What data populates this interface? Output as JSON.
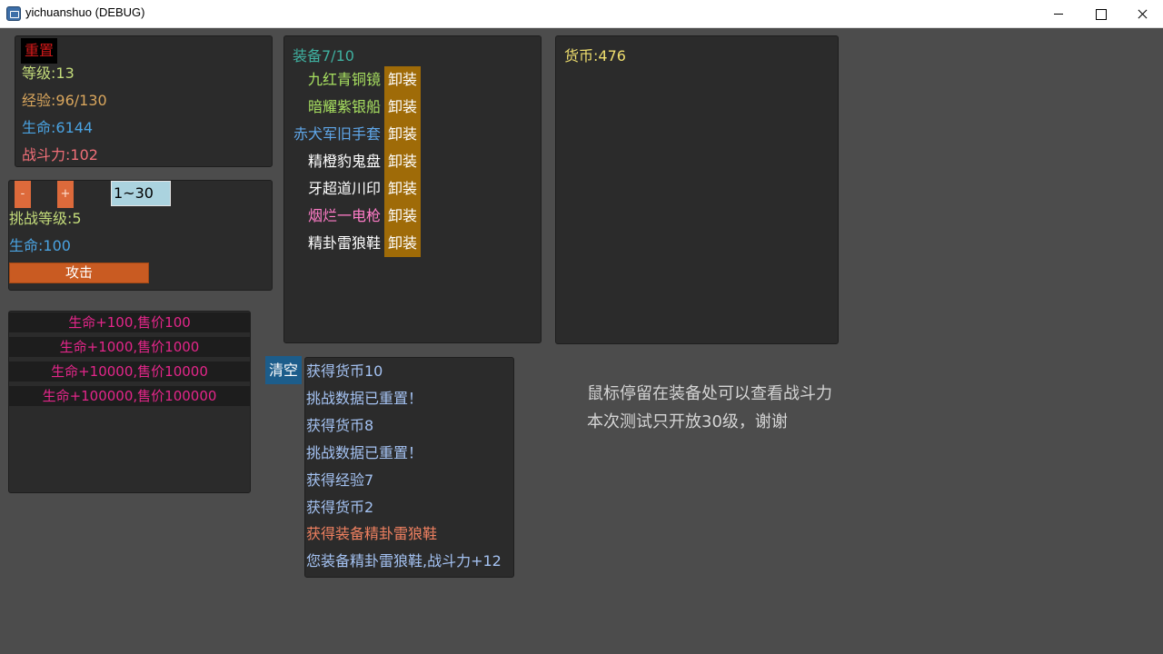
{
  "window": {
    "title": "yichuanshuo (DEBUG)"
  },
  "stats": {
    "reset_label": "重置",
    "level": "等级:13",
    "exp": "经验:96/130",
    "hp": "生命:6144",
    "power": "战斗力:102",
    "colors": {
      "reset": "#d11919",
      "level": "#c3db7a",
      "exp": "#d9a65d",
      "hp": "#4aa3e2",
      "power": "#f06f78"
    }
  },
  "challenge": {
    "minus_label": "-",
    "plus_label": "+",
    "level_input_value": "1~30",
    "challenge_level": "挑战等级:5",
    "hp": "生命:100",
    "attack_label": "攻击",
    "colors": {
      "challenge_level": "#c3db7a",
      "hp": "#4aa3e2",
      "buttons": "#dd6a3b"
    }
  },
  "shop": {
    "items": [
      {
        "label": "生命+100,售价100"
      },
      {
        "label": "生命+1000,售价1000"
      },
      {
        "label": "生命+10000,售价10000"
      },
      {
        "label": "生命+100000,售价100000"
      }
    ],
    "color": "#e4268a"
  },
  "equipment": {
    "header": "装备7/10",
    "header_color": "#3fb0a0",
    "unequip_label": "卸装",
    "items": [
      {
        "name": "九红青铜镜",
        "color": "#a8e060"
      },
      {
        "name": "暗耀紫银船",
        "color": "#a8e060"
      },
      {
        "name": "赤犬军旧手套",
        "color": "#5fa6e8"
      },
      {
        "name": "精橙豹鬼盘",
        "color": "#ffffff"
      },
      {
        "name": "牙超道川印",
        "color": "#ffffff"
      },
      {
        "name": "烟烂一电枪",
        "color": "#ff7cc8"
      },
      {
        "name": "精卦雷狼鞋",
        "color": "#ffffff"
      }
    ]
  },
  "currency": {
    "label": "货币:476",
    "color": "#f0df6e"
  },
  "log": {
    "clear_label": "清空",
    "lines": [
      {
        "text": "获得货币10",
        "color": "#a4c2f2"
      },
      {
        "text": "挑战数据已重置！",
        "color": "#a4c2f2"
      },
      {
        "text": "获得货币8",
        "color": "#a4c2f2"
      },
      {
        "text": "挑战数据已重置！",
        "color": "#a4c2f2"
      },
      {
        "text": "获得经验7",
        "color": "#a4c2f2"
      },
      {
        "text": "获得货币2",
        "color": "#a4c2f2"
      },
      {
        "text": "获得装备精卦雷狼鞋",
        "color": "#ef8060"
      },
      {
        "text": "您装备精卦雷狼鞋,战斗力+12",
        "color": "#a4c2f2"
      }
    ]
  },
  "info": {
    "line1": "鼠标停留在装备处可以查看战斗力",
    "line2": "本次测试只开放30级，谢谢"
  }
}
